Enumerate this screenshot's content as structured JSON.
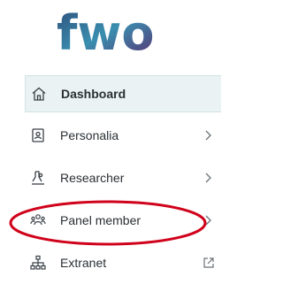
{
  "logo": {
    "text": "fwo",
    "colors": [
      "#2e4d7a",
      "#3a8fb0",
      "#5a2e6e"
    ]
  },
  "nav": {
    "items": [
      {
        "label": "Dashboard",
        "icon": "home-icon",
        "active": true
      },
      {
        "label": "Personalia",
        "icon": "id-card-icon",
        "chevron": true
      },
      {
        "label": "Researcher",
        "icon": "researcher-icon",
        "chevron": true
      },
      {
        "label": "Panel member",
        "icon": "group-icon",
        "chevron": true
      },
      {
        "label": "Extranet",
        "icon": "sitemap-icon",
        "external": true
      }
    ]
  },
  "annotation": {
    "color": "#d0021b",
    "target": "Panel member"
  }
}
